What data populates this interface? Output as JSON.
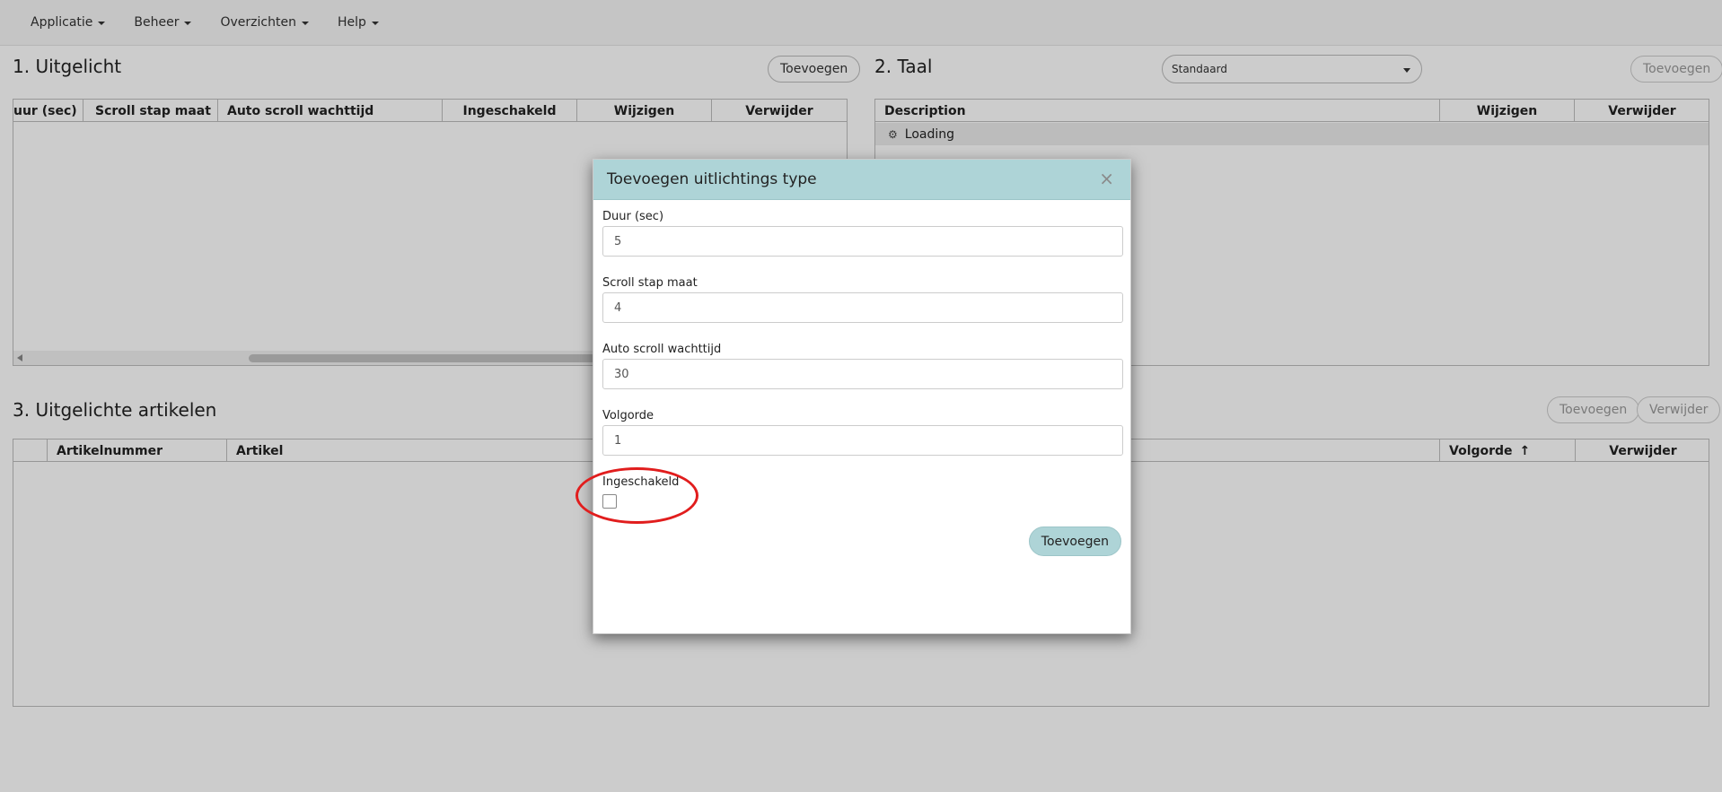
{
  "nav": {
    "items": [
      {
        "label": "Applicatie"
      },
      {
        "label": "Beheer"
      },
      {
        "label": "Overzichten"
      },
      {
        "label": "Help"
      }
    ]
  },
  "panel1": {
    "title": "1. Uitgelicht",
    "add_label": "Toevoegen",
    "columns": [
      "uur (sec)",
      "Scroll stap maat",
      "Auto scroll wachttijd",
      "Ingeschakeld",
      "Wijzigen",
      "Verwijder"
    ]
  },
  "panel2": {
    "title": "2. Taal",
    "select_value": "Standaard",
    "add_label": "Toevoegen",
    "columns": [
      "Description",
      "Wijzigen",
      "Verwijder"
    ],
    "loading_text": "Loading"
  },
  "panel3": {
    "title": "3. Uitgelichte artikelen",
    "add_label": "Toevoegen",
    "remove_label": "Verwijder",
    "columns": [
      "",
      "Artikelnummer",
      "Artikel",
      "Volgorde",
      "Verwijder"
    ],
    "sort_indicator": "↑"
  },
  "modal": {
    "title": "Toevoegen uitlichtings type",
    "close_glyph": "×",
    "fields": {
      "duur": {
        "label": "Duur (sec)",
        "value": "5"
      },
      "scroll": {
        "label": "Scroll stap maat",
        "value": "4"
      },
      "auto": {
        "label": "Auto scroll wachttijd",
        "value": "30"
      },
      "volgorde": {
        "label": "Volgorde",
        "value": "1"
      }
    },
    "enabled_label": "Ingeschakeld",
    "enabled_checked": false,
    "submit_label": "Toevoegen"
  },
  "colors": {
    "modal_header": "#aed4d7",
    "annotation": "#e11d1d"
  }
}
